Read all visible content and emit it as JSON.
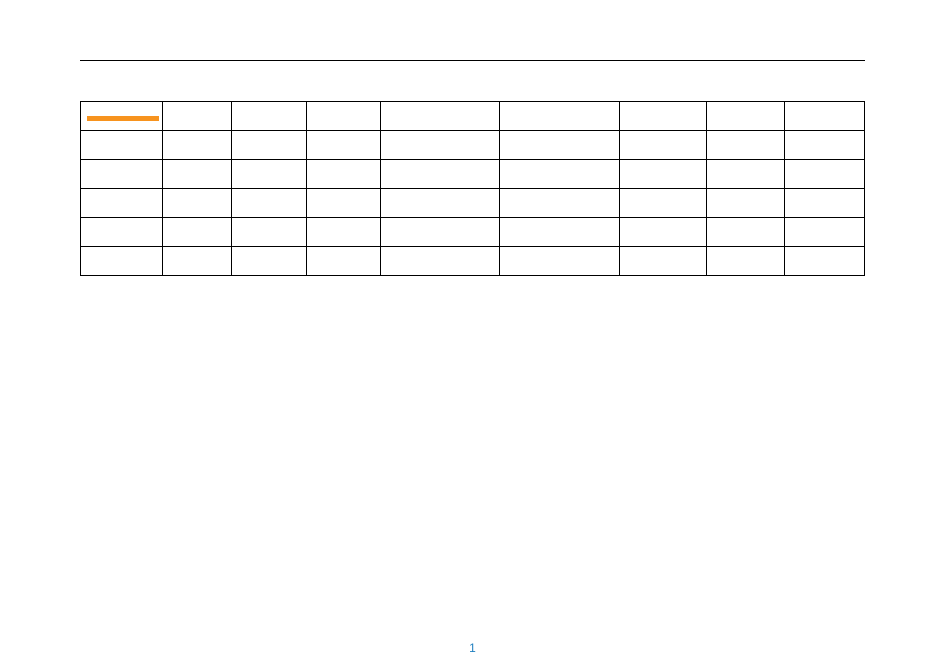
{
  "page": {
    "number": "1"
  },
  "accent_color": "#f7931e",
  "table": {
    "rows": [
      [
        "",
        "",
        "",
        "",
        "",
        "",
        "",
        "",
        ""
      ],
      [
        "",
        "",
        "",
        "",
        "",
        "",
        "",
        "",
        ""
      ],
      [
        "",
        "",
        "",
        "",
        "",
        "",
        "",
        "",
        ""
      ],
      [
        "",
        "",
        "",
        "",
        "",
        "",
        "",
        "",
        ""
      ],
      [
        "",
        "",
        "",
        "",
        "",
        "",
        "",
        "",
        ""
      ],
      [
        "",
        "",
        "",
        "",
        "",
        "",
        "",
        "",
        ""
      ]
    ],
    "has_highlight_first_cell": true
  }
}
